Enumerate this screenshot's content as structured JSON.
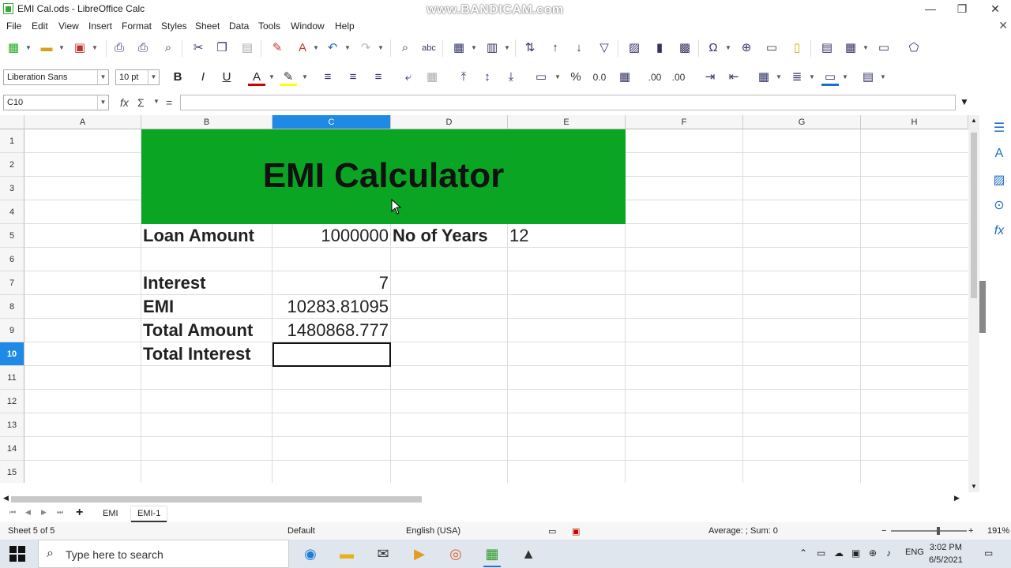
{
  "window": {
    "title": "EMI Cal.ods - LibreOffice Calc",
    "watermark": "www.BANDICAM.com",
    "minimize": "—",
    "maximize": "❐",
    "close": "✕"
  },
  "menu": [
    "File",
    "Edit",
    "View",
    "Insert",
    "Format",
    "Styles",
    "Sheet",
    "Data",
    "Tools",
    "Window",
    "Help"
  ],
  "toolbar": {
    "font_name": "Liberation Sans",
    "font_size": "10 pt",
    "bold": "B",
    "italic": "I",
    "underline": "U",
    "font_color": "A",
    "percent": "%",
    "decimal": "0.0",
    "decimal_add": ".00",
    "decimal_remove": ".00"
  },
  "formula_bar": {
    "name_box": "C10",
    "fx": "fx",
    "sigma": "Σ",
    "equals": "=",
    "content": ""
  },
  "columns": [
    "A",
    "B",
    "C",
    "D",
    "E",
    "F",
    "G",
    "H"
  ],
  "selected_column": "C",
  "rows": [
    "1",
    "2",
    "3",
    "4",
    "5",
    "6",
    "7",
    "8",
    "9",
    "10",
    "11",
    "12",
    "13",
    "14",
    "15"
  ],
  "selected_row": "10",
  "sheet": {
    "banner_title": "EMI Calculator",
    "loan_amount_label": "Loan Amount",
    "loan_amount_value": "1000000",
    "years_label": "No of Years",
    "years_value": "12",
    "interest_label": "Interest",
    "interest_value": "7",
    "emi_label": "EMI",
    "emi_value": "10283.81095",
    "total_amount_label": "Total Amount",
    "total_amount_value": "1480868.777",
    "total_interest_label": "Total Interest",
    "total_interest_value": ""
  },
  "tabs": {
    "add": "+",
    "items": [
      "EMI",
      "EMI-1"
    ],
    "active": "EMI-1"
  },
  "status": {
    "sheet": "Sheet 5 of 5",
    "style": "Default",
    "language": "English (USA)",
    "summary": "Average: ; Sum: 0",
    "zoom_out": "−",
    "zoom_in": "+",
    "zoom": "191%"
  },
  "taskbar": {
    "search_placeholder": "Type here to search",
    "language": "ENG",
    "time": "3:02 PM",
    "date": "6/5/2021"
  },
  "colors": {
    "banner": "#0aa623",
    "selection": "#1e8ae5"
  }
}
